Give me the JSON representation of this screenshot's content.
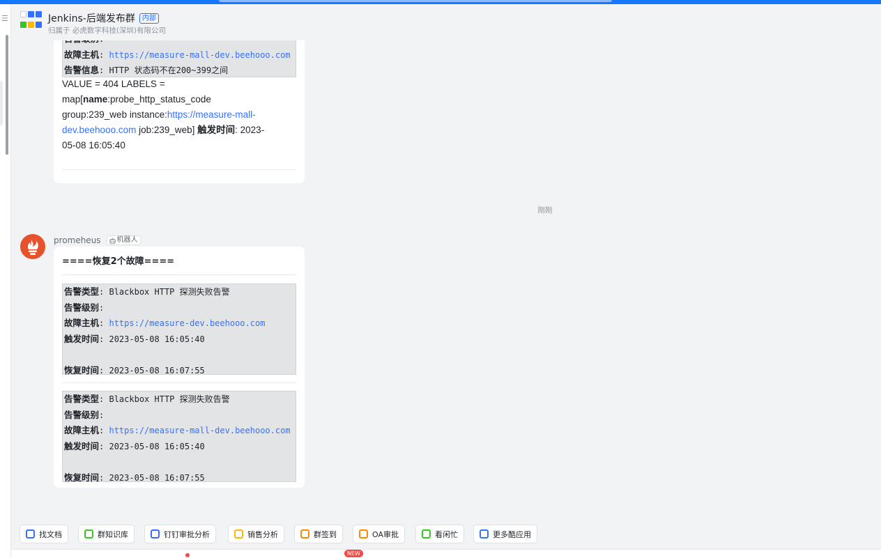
{
  "header": {
    "title": "Jenkins-后端发布群",
    "badge": "内部",
    "subtitle": "归属于 必虎数字科技(深圳)有限公司"
  },
  "message1": {
    "alert_lines": [
      {
        "label": "告警级别",
        "sep": ":",
        "value": "",
        "is_link": false
      },
      {
        "label": "故障主机",
        "sep": ": ",
        "value": "https://measure-mall-dev.beehooo.com",
        "is_link": true
      },
      {
        "label": "告警信息",
        "sep": ": ",
        "value": "HTTP 状态码不在200~399之间",
        "is_link": false
      }
    ],
    "body": {
      "p1": "VALUE = 404 LABELS =",
      "p2": "map[",
      "name_key": "name",
      "p3": ":probe_http_status_code",
      "p4": "group:239_web instance:",
      "link_a": "https://measure-mall-",
      "link_b": "dev.beehooo.com",
      "p5": " job:239_web] ",
      "trigger_label": "触发时间",
      "p6": ": 2023-",
      "p7": "05-08 16:05:40"
    }
  },
  "time_separator": "刚刚",
  "message2": {
    "sender": "promeheus",
    "bot_tag": "机器人",
    "title": "====恢复2个故障====",
    "alerts": [
      {
        "lines": [
          {
            "label": "告警类型",
            "sep": ": ",
            "value": "Blackbox HTTP 探测失败告警",
            "is_link": false
          },
          {
            "label": "告警级别",
            "sep": ":",
            "value": "",
            "is_link": false
          },
          {
            "label": "故障主机",
            "sep": ": ",
            "value": "https://measure-dev.beehooo.com",
            "is_link": true
          },
          {
            "label": "触发时间",
            "sep": ": ",
            "value": "2023-05-08 16:05:40",
            "is_link": false
          },
          {
            "label": "",
            "sep": "",
            "value": "",
            "is_link": false
          },
          {
            "label": "恢复时间",
            "sep": ": ",
            "value": "2023-05-08 16:07:55",
            "is_link": false
          }
        ]
      },
      {
        "lines": [
          {
            "label": "告警类型",
            "sep": ": ",
            "value": "Blackbox HTTP 探测失败告警",
            "is_link": false
          },
          {
            "label": "告警级别",
            "sep": ":",
            "value": "",
            "is_link": false
          },
          {
            "label": "故障主机",
            "sep": ": ",
            "value": "https://measure-mall-dev.beehooo.com",
            "is_link": true
          },
          {
            "label": "触发时间",
            "sep": ": ",
            "value": "2023-05-08 16:05:40",
            "is_link": false
          },
          {
            "label": "",
            "sep": "",
            "value": "",
            "is_link": false
          },
          {
            "label": "恢复时间",
            "sep": ": ",
            "value": "2023-05-08 16:07:55",
            "is_link": false
          }
        ]
      }
    ]
  },
  "apps": [
    {
      "label": "找文档",
      "icon": "search-doc-icon",
      "color": "#3370ff"
    },
    {
      "label": "群知识库",
      "icon": "knowledge-base-icon",
      "color": "#34c724"
    },
    {
      "label": "钉钉审批分析",
      "icon": "approval-analysis-icon",
      "color": "#3370ff"
    },
    {
      "label": "销售分析",
      "icon": "sales-analysis-icon",
      "color": "#ffb800"
    },
    {
      "label": "群签到",
      "icon": "location-checkin-icon",
      "color": "#ff8800"
    },
    {
      "label": "OA审批",
      "icon": "oa-approval-icon",
      "color": "#ff8800"
    },
    {
      "label": "看闲忙",
      "icon": "calendar-check-icon",
      "color": "#34c724"
    },
    {
      "label": "更多酷应用",
      "icon": "more-apps-icon",
      "color": "#3370ff"
    }
  ],
  "toolbar": {
    "new_badge": "NEW"
  },
  "colors": {
    "accent": "#3370ff",
    "top_bar": "#1677ff",
    "alert_bg": "#e3e4e6",
    "bot_avatar": "#e85a2c"
  }
}
